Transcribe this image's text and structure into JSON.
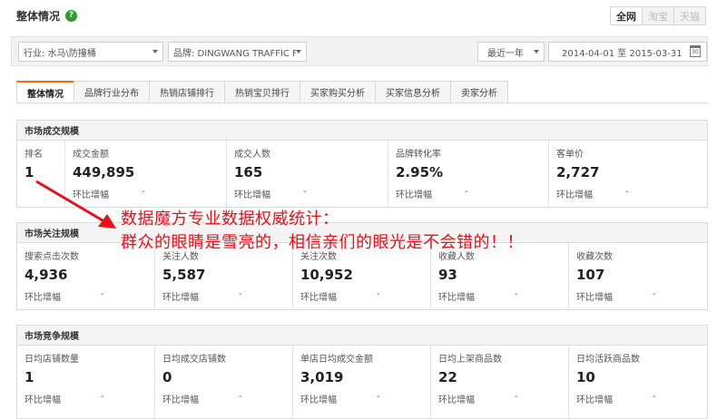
{
  "header": {
    "title": "整体情况",
    "help_icon": "question-icon"
  },
  "platform": {
    "options": [
      "全网",
      "淘宝",
      "天猫"
    ],
    "active": "全网"
  },
  "filters": {
    "industry": "行业: 水马\\防撞桶",
    "brand": "品牌: DINGWANG TRAFFIC F",
    "period": "最近一年",
    "date_range": "2014-04-01 至 2015-03-31",
    "calendar_label": "30"
  },
  "tabs": [
    "整体情况",
    "品牌行业分布",
    "热销店铺排行",
    "热销宝贝排行",
    "买家购买分析",
    "买家信息分析",
    "卖家分析"
  ],
  "change_label": "环比增幅",
  "change_value": "-",
  "scale": {
    "title": "市场成交规模",
    "rank_label": "排名",
    "rank_value": "1",
    "metrics": [
      {
        "label": "成交金额",
        "value": "449,895"
      },
      {
        "label": "成交人数",
        "value": "165"
      },
      {
        "label": "品牌转化率",
        "value": "2.95%"
      },
      {
        "label": "客单价",
        "value": "2,727"
      }
    ]
  },
  "attention": {
    "title": "市场关注规模",
    "metrics": [
      {
        "label": "搜索点击次数",
        "value": "4,936"
      },
      {
        "label": "关注人数",
        "value": "5,587"
      },
      {
        "label": "关注次数",
        "value": "10,952"
      },
      {
        "label": "收藏人数",
        "value": "93"
      },
      {
        "label": "收藏次数",
        "value": "107"
      }
    ]
  },
  "competition": {
    "title": "市场竞争规模",
    "metrics": [
      {
        "label": "日均店铺数量",
        "value": "1"
      },
      {
        "label": "日均成交店铺数",
        "value": "0"
      },
      {
        "label": "单店日均成交金额",
        "value": "3,019"
      },
      {
        "label": "日均上架商品数",
        "value": "22"
      },
      {
        "label": "日均活跃商品数",
        "value": "10"
      }
    ]
  },
  "annotation": {
    "line1": "数据魔方专业数据权威统计：",
    "line2": "群众的眼睛是雪亮的，相信亲们的眼光是不会错的！！",
    "color": "#e8101a"
  }
}
